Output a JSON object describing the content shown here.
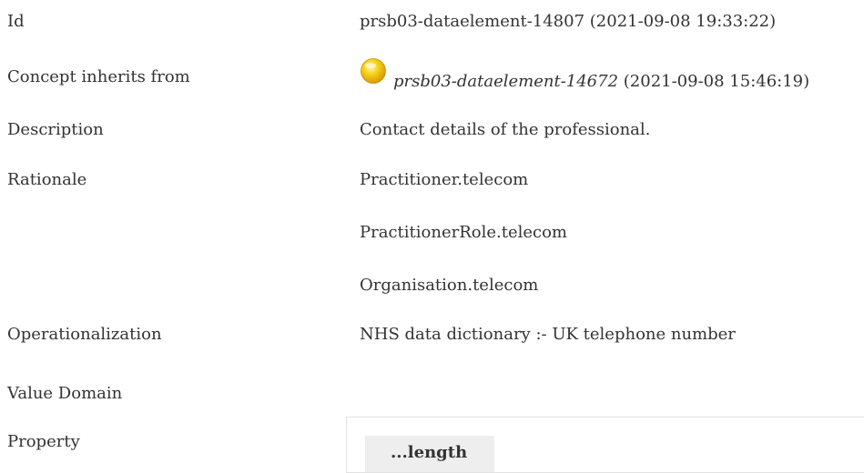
{
  "id_row": {
    "label": "Id",
    "value": "prsb03-dataelement-14807 (2021-09-08 19:33:22)"
  },
  "inherits_row": {
    "label": "Concept inherits from",
    "ref": "prsb03-dataelement-14672",
    "date": " (2021-09-08 15:46:19)",
    "icon": "yellow-circle-icon"
  },
  "description_row": {
    "label": "Description",
    "value": "Contact details of the professional."
  },
  "rationale_row": {
    "label": "Rationale",
    "lines": [
      "Practitioner.telecom",
      "PractitionerRole.telecom",
      "Organisation.telecom"
    ]
  },
  "operationalization_row": {
    "label": "Operationalization",
    "value": "NHS data dictionary :- UK telephone number"
  },
  "value_domain_row": {
    "label": "Value Domain"
  },
  "property_row": {
    "label": "Property",
    "cell_text": "...length"
  },
  "colors": {
    "text": "#333333",
    "icon": "#f5c400",
    "property_cell_bg": "#eeeeee",
    "property_border": "#e2e2e2"
  }
}
